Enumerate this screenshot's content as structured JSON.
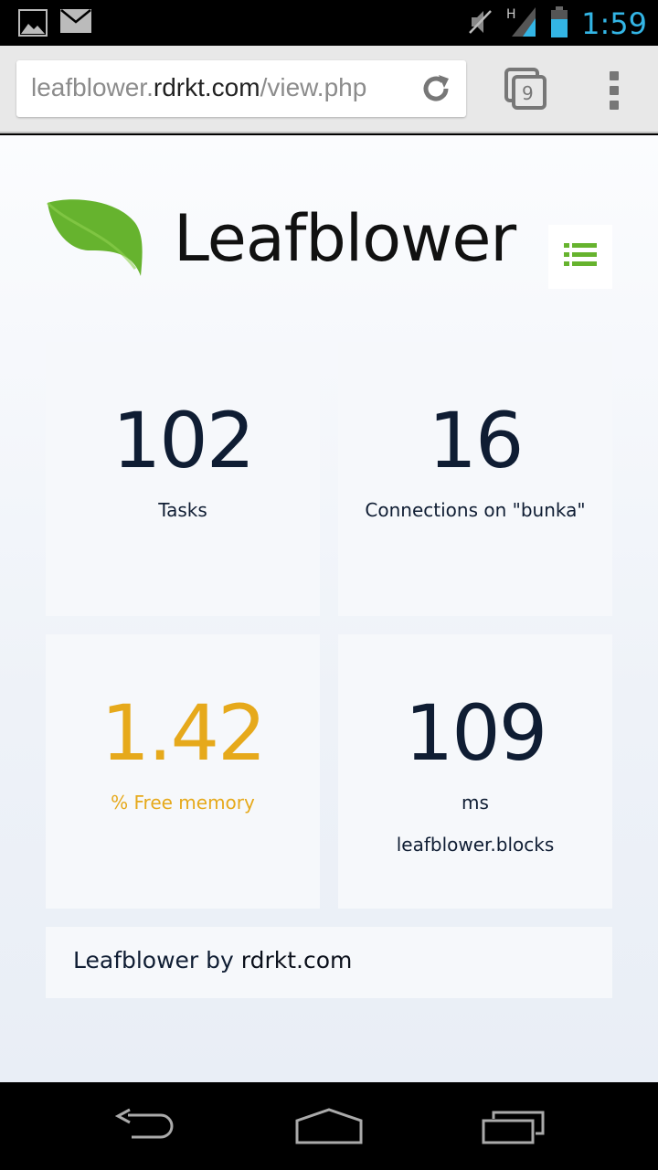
{
  "status_bar": {
    "time": "1:59",
    "icons": [
      "gallery-icon",
      "mail-icon",
      "mute-icon",
      "signal-icon",
      "battery-icon"
    ],
    "signal_label": "H"
  },
  "browser": {
    "url_prefix": "leafblower.",
    "url_domain": "rdrkt.com",
    "url_suffix": "/view.php",
    "tab_count": "9"
  },
  "header": {
    "logo_text": "Leafblower"
  },
  "tiles": [
    {
      "value": "102",
      "label": "Tasks"
    },
    {
      "value": "16",
      "label": "Connections on \"bunka\""
    },
    {
      "value": "1.42",
      "label": "% Free memory"
    },
    {
      "value": "109",
      "label": "ms",
      "sublabel": "leafblower.blocks"
    }
  ],
  "footer": {
    "text_prefix": "Leafblower by ",
    "text_domain": "rdrkt.com"
  },
  "colors": {
    "accent_green": "#66b32e",
    "warning": "#e6a91b",
    "clock": "#33b5e5",
    "text_dark": "#0f1d33"
  }
}
